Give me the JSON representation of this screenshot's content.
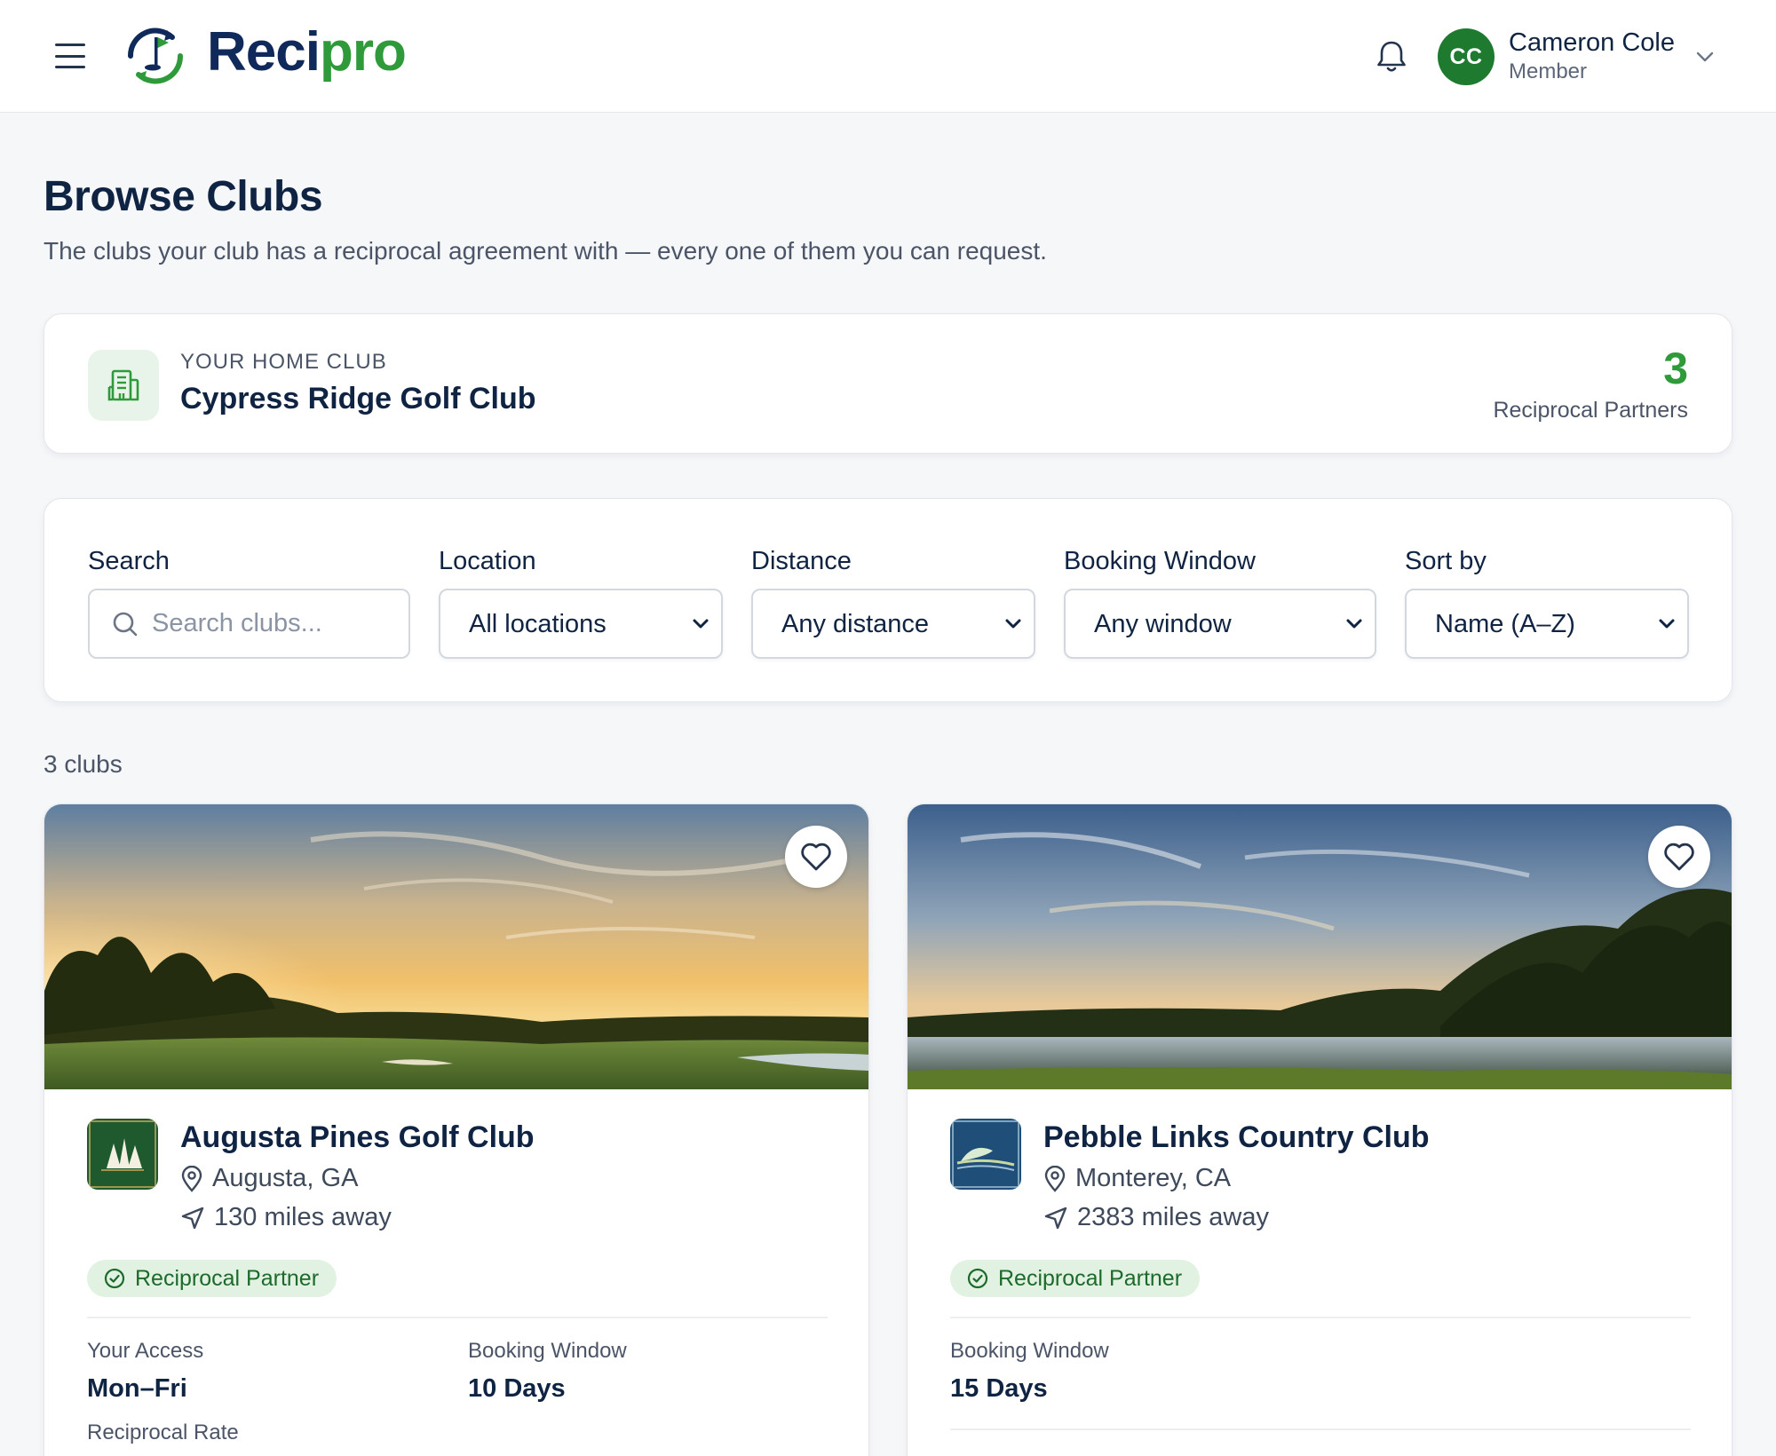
{
  "app": {
    "brand_part1": "Reci",
    "brand_part2": "pro",
    "brand_colors": {
      "navy": "#0f2a5a",
      "green": "#2e9a3a"
    }
  },
  "user": {
    "initials": "CC",
    "name": "Cameron Cole",
    "role": "Member"
  },
  "page": {
    "title": "Browse Clubs",
    "subtitle": "The clubs your club has a reciprocal agreement with — every one of them you can request."
  },
  "home_club": {
    "label": "YOUR HOME CLUB",
    "name": "Cypress Ridge Golf Club",
    "partners_count": "3",
    "partners_label": "Reciprocal Partners"
  },
  "filters": {
    "search": {
      "label": "Search",
      "placeholder": "Search clubs..."
    },
    "location": {
      "label": "Location",
      "value": "All locations"
    },
    "distance": {
      "label": "Distance",
      "value": "Any distance"
    },
    "booking_window": {
      "label": "Booking Window",
      "value": "Any window"
    },
    "sort": {
      "label": "Sort by",
      "value": "Name (A–Z)"
    }
  },
  "results": {
    "count_text": "3 clubs"
  },
  "clubs": [
    {
      "name": "Augusta Pines Golf Club",
      "location": "Augusta, GA",
      "distance": "130 miles away",
      "badge": "Reciprocal Partner",
      "logo_text": "AUGUSTA PINES",
      "access_label": "Your Access",
      "access_value": "Mon–Fri",
      "booking_label": "Booking Window",
      "booking_value": "10 Days",
      "rate_label": "Reciprocal Rate"
    },
    {
      "name": "Pebble Links Country Club",
      "location": "Monterey, CA",
      "distance": "2383 miles away",
      "badge": "Reciprocal Partner",
      "logo_text": "PEBBLE LINKS",
      "booking_label": "Booking Window",
      "booking_value": "15 Days"
    }
  ]
}
